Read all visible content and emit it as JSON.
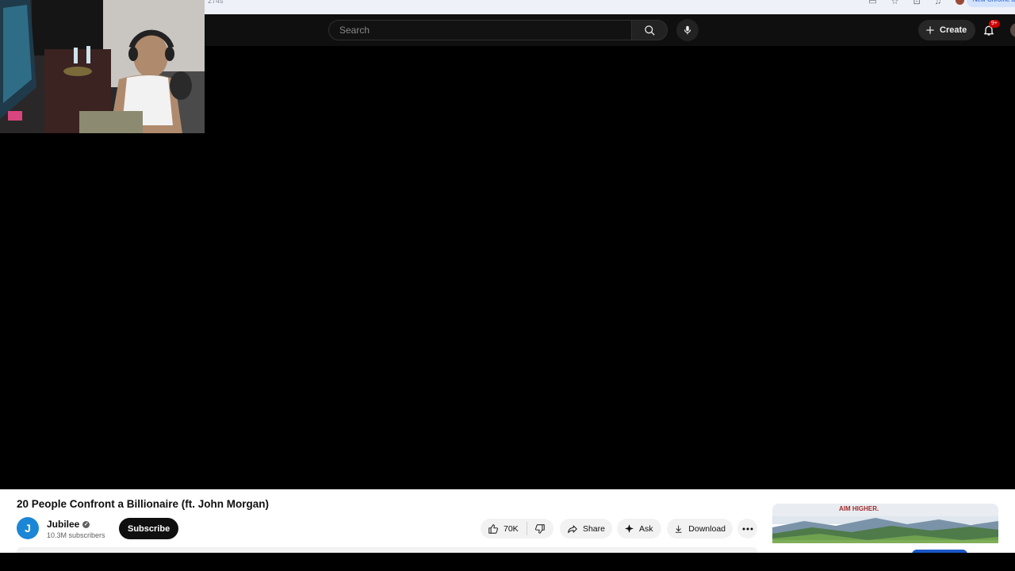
{
  "browser": {
    "url_fragment": "274s",
    "new_chrome_label": "New Chrome a"
  },
  "masthead": {
    "search_placeholder": "Search",
    "create_label": "Create",
    "notification_badge": "9+"
  },
  "video": {
    "title": "20 People Confront a Billionaire (ft. John Morgan)"
  },
  "channel": {
    "name": "Jubilee",
    "avatar_letter": "J",
    "subscribers": "10.3M subscribers",
    "subscribe_label": "Subscribe"
  },
  "actions": {
    "like_count": "70K",
    "share_label": "Share",
    "ask_label": "Ask",
    "download_label": "Download"
  },
  "ad": {
    "headline": "AIM HIGHER."
  },
  "colors": {
    "masthead_bg": "#0f0f0f",
    "subscribe_bg": "#0f0f0f",
    "pill_bg": "#f2f2f2",
    "badge": "#cc0000"
  }
}
